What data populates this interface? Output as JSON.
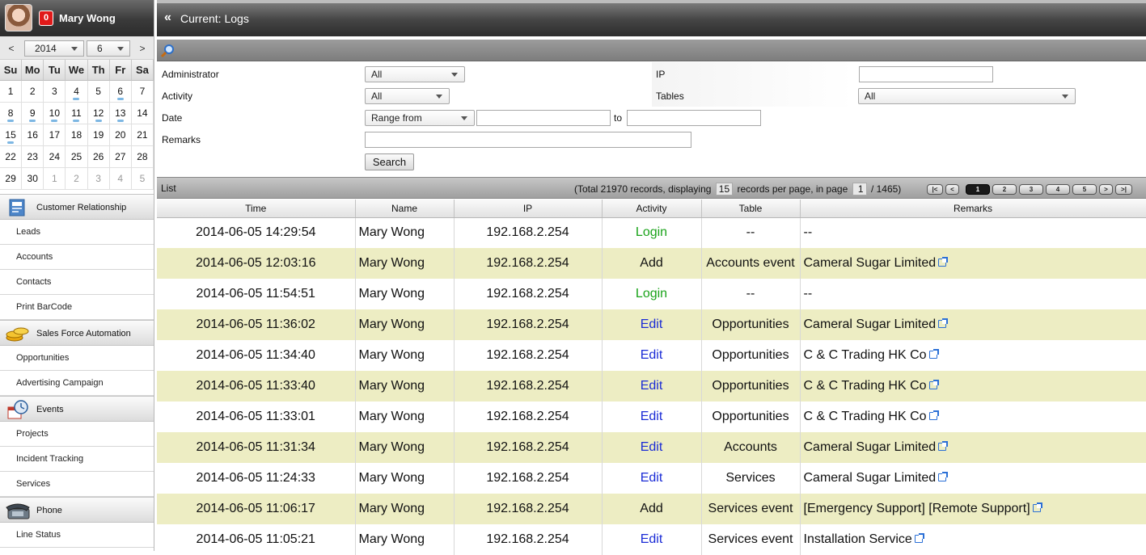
{
  "user": {
    "name": "Mary Wong",
    "notifications": "0"
  },
  "calendar": {
    "prev": "<",
    "next": ">",
    "year": "2014",
    "month": "6",
    "weekdays": [
      "Su",
      "Mo",
      "Tu",
      "We",
      "Th",
      "Fr",
      "Sa"
    ],
    "days": [
      "1",
      "2",
      "3",
      "4",
      "5",
      "6",
      "7",
      "8",
      "9",
      "10",
      "11",
      "12",
      "13",
      "14",
      "15",
      "16",
      "17",
      "18",
      "19",
      "20",
      "21",
      "22",
      "23",
      "24",
      "25",
      "26",
      "27",
      "28",
      "29",
      "30",
      "1",
      "2",
      "3",
      "4",
      "5"
    ]
  },
  "menu": {
    "customer_relationship": "Customer Relationship",
    "leads": "Leads",
    "accounts": "Accounts",
    "contacts": "Contacts",
    "print_barcode": "Print BarCode",
    "sales_force": "Sales Force Automation",
    "opportunities": "Opportunities",
    "advertising": "Advertising Campaign",
    "events": "Events",
    "projects": "Projects",
    "incident": "Incident Tracking",
    "services": "Services",
    "phone": "Phone",
    "line_status": "Line Status"
  },
  "header": {
    "collapse": "«",
    "title": "Current: Logs"
  },
  "filter": {
    "administrator_label": "Administrator",
    "administrator_value": "All",
    "activity_label": "Activity",
    "activity_value": "All",
    "date_label": "Date",
    "date_value": "Range from",
    "to": "to",
    "remarks_label": "Remarks",
    "ip_label": "IP",
    "tables_label": "Tables",
    "tables_value": "All",
    "search_button": "Search"
  },
  "list": {
    "label": "List",
    "info_pre": "(Total 21970 records, displaying",
    "per_page": "15",
    "info_mid": "records per page, in page",
    "page": "1",
    "info_post": "/ 1465)",
    "pager": {
      "first": "|<",
      "prev": "<",
      "pages": [
        "1",
        "2",
        "3",
        "4",
        "5"
      ],
      "next": ">",
      "last": ">|"
    },
    "columns": [
      "Time",
      "Name",
      "IP",
      "Activity",
      "Table",
      "Remarks"
    ],
    "rows": [
      {
        "time": "2014-06-05 14:29:54",
        "name": "Mary Wong",
        "ip": "192.168.2.254",
        "activity": "Login",
        "table": "--",
        "remarks": "--",
        "link": false
      },
      {
        "time": "2014-06-05 12:03:16",
        "name": "Mary Wong",
        "ip": "192.168.2.254",
        "activity": "Add",
        "table": "Accounts event",
        "remarks": "Cameral Sugar Limited",
        "link": true
      },
      {
        "time": "2014-06-05 11:54:51",
        "name": "Mary Wong",
        "ip": "192.168.2.254",
        "activity": "Login",
        "table": "--",
        "remarks": "--",
        "link": false
      },
      {
        "time": "2014-06-05 11:36:02",
        "name": "Mary Wong",
        "ip": "192.168.2.254",
        "activity": "Edit",
        "table": "Opportunities",
        "remarks": "Cameral Sugar Limited",
        "link": true
      },
      {
        "time": "2014-06-05 11:34:40",
        "name": "Mary Wong",
        "ip": "192.168.2.254",
        "activity": "Edit",
        "table": "Opportunities",
        "remarks": "C & C Trading HK Co",
        "link": true
      },
      {
        "time": "2014-06-05 11:33:40",
        "name": "Mary Wong",
        "ip": "192.168.2.254",
        "activity": "Edit",
        "table": "Opportunities",
        "remarks": "C & C Trading HK Co",
        "link": true
      },
      {
        "time": "2014-06-05 11:33:01",
        "name": "Mary Wong",
        "ip": "192.168.2.254",
        "activity": "Edit",
        "table": "Opportunities",
        "remarks": "C & C Trading HK Co",
        "link": true
      },
      {
        "time": "2014-06-05 11:31:34",
        "name": "Mary Wong",
        "ip": "192.168.2.254",
        "activity": "Edit",
        "table": "Accounts",
        "remarks": "Cameral Sugar Limited",
        "link": true
      },
      {
        "time": "2014-06-05 11:24:33",
        "name": "Mary Wong",
        "ip": "192.168.2.254",
        "activity": "Edit",
        "table": "Services",
        "remarks": "Cameral Sugar Limited",
        "link": true
      },
      {
        "time": "2014-06-05 11:06:17",
        "name": "Mary Wong",
        "ip": "192.168.2.254",
        "activity": "Add",
        "table": "Services event",
        "remarks": "[Emergency Support] [Remote Support]",
        "link": true
      },
      {
        "time": "2014-06-05 11:05:21",
        "name": "Mary Wong",
        "ip": "192.168.2.254",
        "activity": "Edit",
        "table": "Services event",
        "remarks": "Installation Service",
        "link": true
      }
    ]
  },
  "colors": {
    "login": "#1aa31a",
    "edit": "#1a2bd6",
    "alt_row": "#ededc3",
    "badge": "#e01a1a"
  }
}
